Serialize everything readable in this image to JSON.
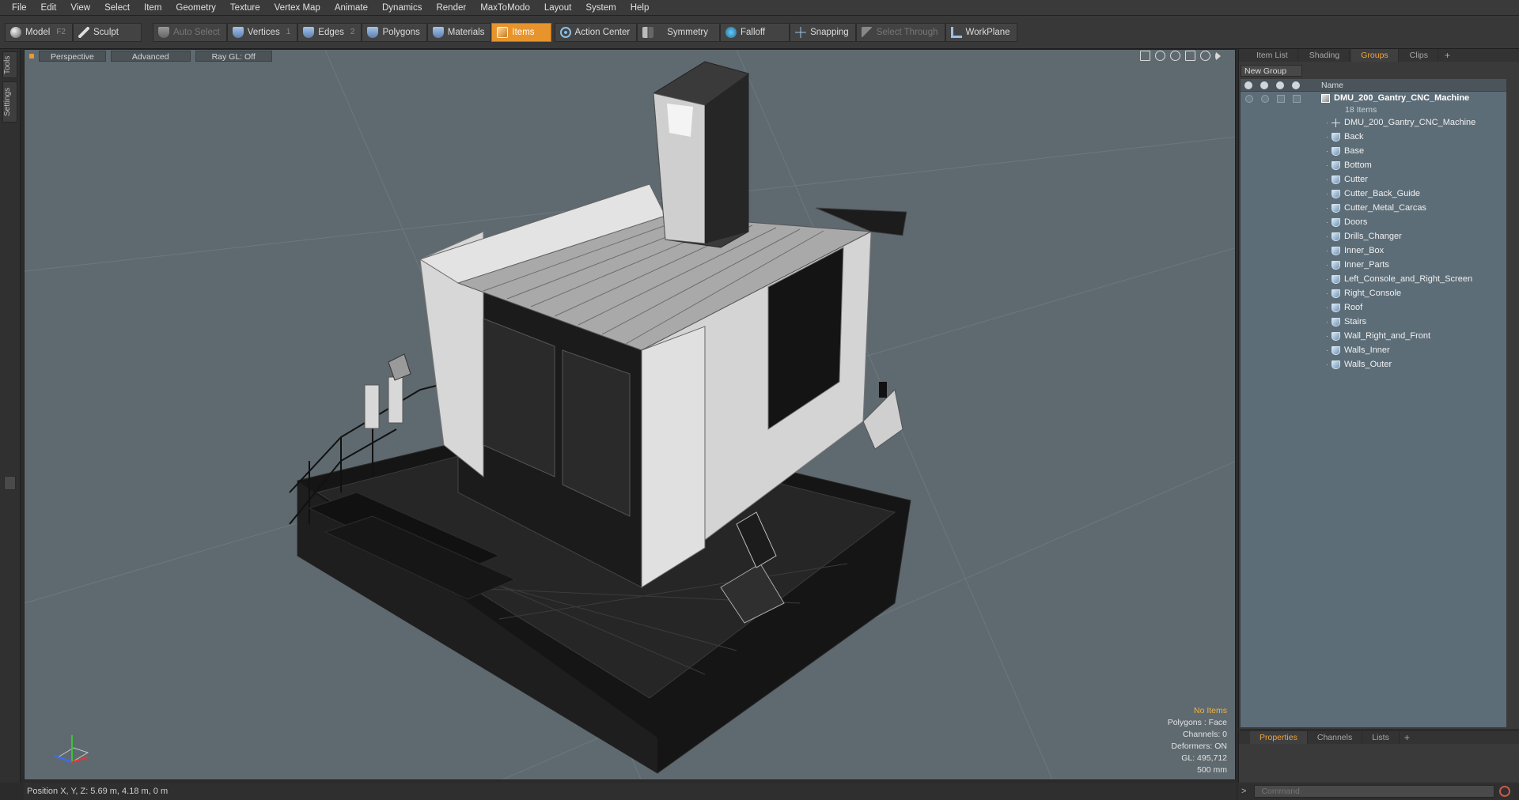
{
  "menu": [
    "File",
    "Edit",
    "View",
    "Select",
    "Item",
    "Geometry",
    "Texture",
    "Vertex Map",
    "Animate",
    "Dynamics",
    "Render",
    "MaxToModo",
    "Layout",
    "System",
    "Help"
  ],
  "toolbar": {
    "model": "Model",
    "model_key": "F2",
    "sculpt": "Sculpt",
    "auto_select": "Auto Select",
    "vertices": "Vertices",
    "vertices_key": "1",
    "edges": "Edges",
    "edges_key": "2",
    "polygons": "Polygons",
    "materials": "Materials",
    "items": "Items",
    "action_center": "Action Center",
    "symmetry": "Symmetry",
    "falloff": "Falloff",
    "snapping": "Snapping",
    "select_through": "Select Through",
    "workplane": "WorkPlane"
  },
  "left_tabs": [
    "Tools",
    "Settings"
  ],
  "viewport": {
    "tabs": [
      "Perspective",
      "Advanced",
      "Ray GL: Off"
    ],
    "stats": {
      "selection": "No Items",
      "polygons": "Polygons : Face",
      "channels": "Channels: 0",
      "deformers": "Deformers: ON",
      "gl": "GL: 495,712",
      "scale": "500 mm"
    }
  },
  "status": "Position X, Y, Z:  5.69 m, 4.18 m, 0 m",
  "panel": {
    "tabs": [
      "Item List",
      "Shading",
      "Groups",
      "Clips"
    ],
    "active_tab": "Groups",
    "plus": "+",
    "new_group": "New Group",
    "name_column": "Name",
    "group_name": "DMU_200_Gantry_CNC_Machine",
    "group_count": "18 Items",
    "items": [
      "DMU_200_Gantry_CNC_Machine",
      "Back",
      "Base",
      "Bottom",
      "Cutter",
      "Cutter_Back_Guide",
      "Cutter_Metal_Carcas",
      "Doors",
      "Drills_Changer",
      "Inner_Box",
      "Inner_Parts",
      "Left_Console_and_Right_Screen",
      "Right_Console",
      "Roof",
      "Stairs",
      "Wall_Right_and_Front",
      "Walls_Inner",
      "Walls_Outer"
    ]
  },
  "props": {
    "tabs": [
      "Properties",
      "Channels",
      "Lists"
    ],
    "active_tab": "Properties",
    "plus": "+"
  },
  "command": {
    "arrow": ">",
    "placeholder": "Command"
  }
}
